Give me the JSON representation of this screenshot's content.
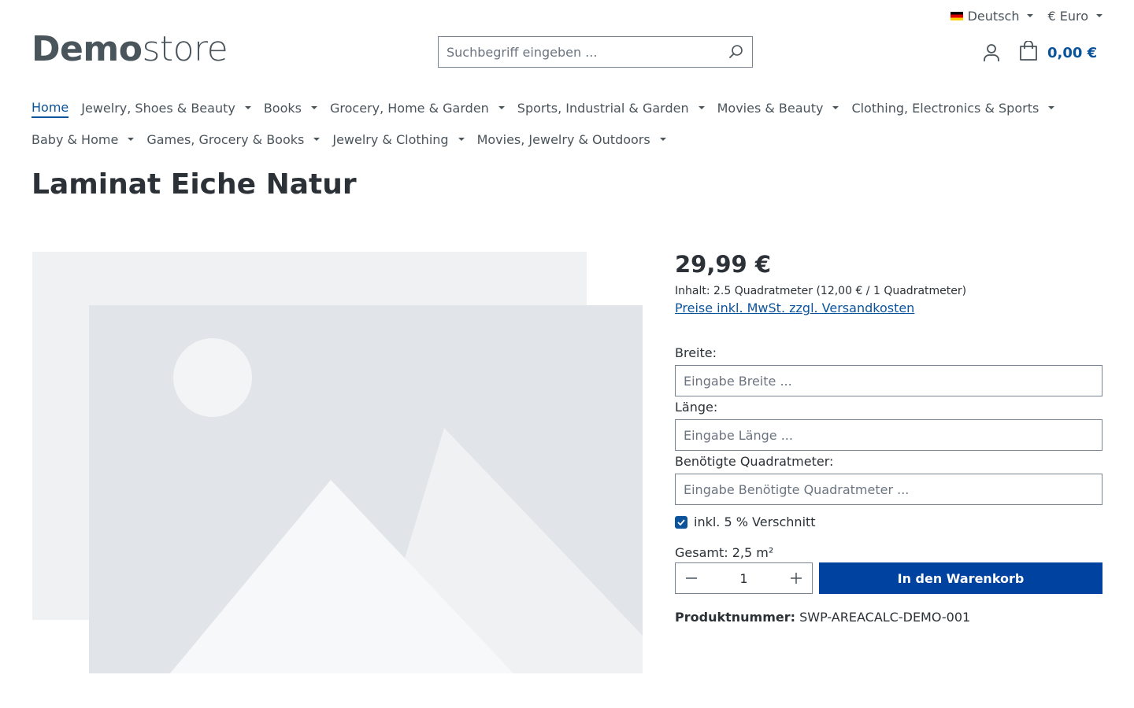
{
  "topbar": {
    "language": "Deutsch",
    "currency": "€ Euro"
  },
  "logo": {
    "bold": "Demo",
    "light": "store"
  },
  "search": {
    "placeholder": "Suchbegriff eingeben ..."
  },
  "cart": {
    "total": "0,00 €"
  },
  "nav": {
    "row1": [
      {
        "label": "Home",
        "active": true,
        "dropdown": false
      },
      {
        "label": "Jewelry, Shoes & Beauty",
        "dropdown": true
      },
      {
        "label": "Books",
        "dropdown": true
      },
      {
        "label": "Grocery, Home & Garden",
        "dropdown": true
      },
      {
        "label": "Sports, Industrial & Garden",
        "dropdown": true
      },
      {
        "label": "Movies & Beauty",
        "dropdown": true
      },
      {
        "label": "Clothing, Electronics & Sports",
        "dropdown": true
      }
    ],
    "row2": [
      {
        "label": "Baby & Home",
        "dropdown": true
      },
      {
        "label": "Games, Grocery & Books",
        "dropdown": true
      },
      {
        "label": "Jewelry & Clothing",
        "dropdown": true
      },
      {
        "label": "Movies, Jewelry & Outdoors",
        "dropdown": true
      }
    ]
  },
  "product": {
    "title": "Laminat Eiche Natur",
    "price": "29,99 €",
    "unit_info": "Inhalt: 2.5 Quadratmeter (12,00 € / 1 Quadratmeter)",
    "tax_link": "Preise inkl. MwSt. zzgl. Versandkosten",
    "width_label": "Breite:",
    "width_placeholder": "Eingabe Breite ...",
    "length_label": "Länge:",
    "length_placeholder": "Eingabe Länge ...",
    "area_label": "Benötigte Quadratmeter:",
    "area_placeholder": "Eingabe Benötigte Quadratmeter ...",
    "waste_label": "inkl. 5 % Verschnitt",
    "waste_checked": true,
    "total": "Gesamt: 2,5 m²",
    "quantity": "1",
    "add_to_cart": "In den Warenkorb",
    "sku_label": "Produktnummer:",
    "sku_value": "SWP-AREACALC-DEMO-001"
  },
  "colors": {
    "primary": "#0042a0",
    "link": "#0b539b",
    "text": "#4a545b",
    "placeholder_bg": "#f0f1f3"
  }
}
